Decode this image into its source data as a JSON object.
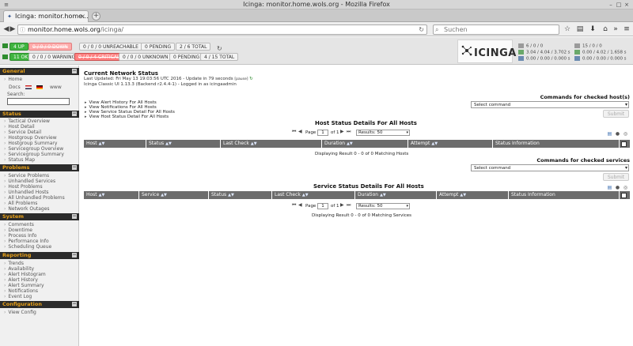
{
  "window": {
    "title": "Icinga: monitor.home.wols.org - Mozilla Firefox"
  },
  "tab": {
    "title": "Icinga: monitor.home...",
    "close": "×",
    "new": "+"
  },
  "nav": {
    "url_host": "monitor.home.wols.org",
    "url_path": "/icinga/",
    "search_placeholder": "Suchen"
  },
  "status": {
    "hosts_up": "4 UP",
    "hosts_down": "0 / 0 / 0 DOWN",
    "hosts_unreachable": "0 / 0 / 0 UNREACHABLE",
    "hosts_pending": "0 PENDING",
    "hosts_total": "2 / 6 TOTAL",
    "svc_ok": "11 OK",
    "svc_warning": "0 / 0 / 0 WARNING",
    "svc_critical": "0 / 0 / 4 CRITICAL",
    "svc_unknown": "0 / 0 / 0 UNKNOWN",
    "svc_pending": "0 PENDING",
    "svc_total": "4 / 15 TOTAL"
  },
  "logo": "ICINGA",
  "stats": {
    "col1": [
      "6 / 0 / 0",
      "3.04 / 4.04 / 3.702 s",
      "0.00 / 0.00 / 0.000 s"
    ],
    "col2": [
      "15 / 0 / 0",
      "0.00 / 4.02 / 1.658 s",
      "0.00 / 0.00 / 0.000 s"
    ]
  },
  "sidebar": {
    "general": {
      "title": "General",
      "home": "Home",
      "docs": "Docs",
      "www": "www",
      "search_label": "Search:"
    },
    "status": {
      "title": "Status",
      "items": [
        "Tactical Overview",
        "Host Detail",
        "Service Detail",
        "Hostgroup Overview",
        "Hostgroup Summary",
        "Servicegroup Overview",
        "Servicegroup Summary",
        "Status Map"
      ]
    },
    "problems": {
      "title": "Problems",
      "items": [
        "Service Problems",
        "Unhandled Services",
        "Host Problems",
        "Unhandled Hosts",
        "All Unhandled Problems",
        "All Problems",
        "Network Outages"
      ]
    },
    "system": {
      "title": "System",
      "items": [
        "Comments",
        "Downtime",
        "Process Info",
        "Performance Info",
        "Scheduling Queue"
      ]
    },
    "reporting": {
      "title": "Reporting",
      "items": [
        "Trends",
        "Availability",
        "Alert Histogram",
        "Alert History",
        "Alert Summary",
        "Notifications",
        "Event Log"
      ]
    },
    "configuration": {
      "title": "Configuration",
      "items": [
        "View Config"
      ]
    }
  },
  "main": {
    "heading": "Current Network Status",
    "last_updated": "Last Updated: Fri May 13 19:03:56 UTC 2016 - Update in 79 seconds",
    "pause": "[pause]",
    "version_line": "Icinga Classic UI 1.13.3 (Backend r2.4.4-1) - Logged in as icingaadmin",
    "links": [
      "View Alert History For All Hosts",
      "View Notifications For All Hosts",
      "View Service Status Detail For All Hosts",
      "View Host Status Detail For All Hosts"
    ],
    "host_cmd_title": "Commands for checked host(s)",
    "svc_cmd_title": "Commands for checked services",
    "select_command": "Select command",
    "submit": "Submit",
    "host_table_title": "Host Status Details For All Hosts",
    "svc_table_title": "Service Status Details For All Hosts",
    "host_cols": [
      "Host",
      "Status",
      "Last Check",
      "Duration",
      "Attempt",
      "Status Information"
    ],
    "svc_cols": [
      "Host",
      "Service",
      "Status",
      "Last Check",
      "Duration",
      "Attempt",
      "Status Information"
    ],
    "page_label": "Page",
    "page_value": "1",
    "of_label": "of 1",
    "results_label": "Results: 50",
    "host_display": "Displaying Result 0 - 0 of 0 Matching Hosts",
    "svc_display": "Displaying Result 0 - 0 of 0 Matching Services"
  }
}
